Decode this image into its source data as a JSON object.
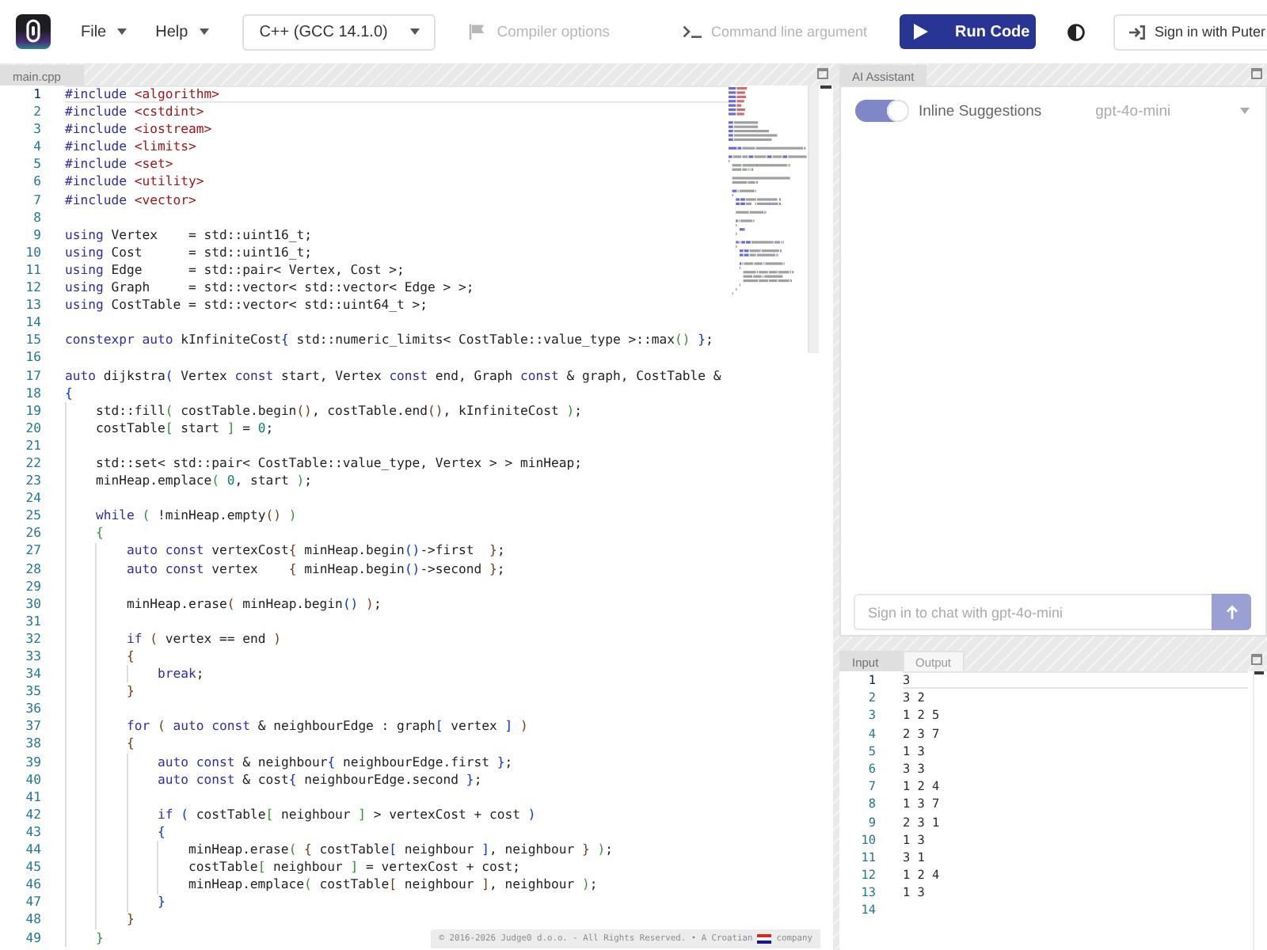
{
  "topbar": {
    "menus": [
      {
        "label": "File"
      },
      {
        "label": "Help"
      }
    ],
    "language": {
      "value": "C++ (GCC 14.1.0)"
    },
    "compiler_options": {
      "label": "Compiler options",
      "disabled": true
    },
    "arguments": {
      "placeholder": "Command line argument"
    },
    "run_button": {
      "label": "Run Code"
    },
    "sign_in": {
      "label": "Sign in with Puter"
    }
  },
  "editor": {
    "tab": "main.cpp",
    "lines": [
      {
        "number": "1",
        "active": true,
        "tokens": [
          {
            "kind": "keyword",
            "text": "#include"
          },
          {
            "kind": "header",
            "text": " <algorithm>"
          }
        ]
      },
      {
        "number": "2",
        "active": false,
        "tokens": [
          {
            "kind": "keyword",
            "text": "#include"
          },
          {
            "kind": "header",
            "text": " <cstdint>"
          }
        ]
      },
      {
        "number": "3",
        "active": false,
        "tokens": [
          {
            "kind": "keyword",
            "text": "#include"
          },
          {
            "kind": "header",
            "text": " <iostream>"
          }
        ]
      },
      {
        "number": "4",
        "active": false,
        "tokens": [
          {
            "kind": "keyword",
            "text": "#include"
          },
          {
            "kind": "header",
            "text": " <limits>"
          }
        ]
      },
      {
        "number": "5",
        "active": false,
        "tokens": [
          {
            "kind": "keyword",
            "text": "#include"
          },
          {
            "kind": "header",
            "text": " <set>"
          }
        ]
      },
      {
        "number": "6",
        "active": false,
        "tokens": [
          {
            "kind": "keyword",
            "text": "#include"
          },
          {
            "kind": "header",
            "text": " <utility>"
          }
        ]
      },
      {
        "number": "7",
        "active": false,
        "tokens": [
          {
            "kind": "keyword",
            "text": "#include"
          },
          {
            "kind": "header",
            "text": " <vector>"
          }
        ]
      },
      {
        "number": "8",
        "active": false
      },
      {
        "number": "9",
        "active": false,
        "tokens": [
          {
            "kind": "keyword",
            "text": "using"
          },
          {
            "kind": "text",
            "text": " Vertex    = std::uint16_t;"
          }
        ]
      },
      {
        "number": "10",
        "active": false,
        "tokens": [
          {
            "kind": "keyword",
            "text": "using"
          },
          {
            "kind": "text",
            "text": " Cost      = std::uint16_t;"
          }
        ]
      },
      {
        "number": "11",
        "active": false,
        "tokens": [
          {
            "kind": "keyword",
            "text": "using"
          },
          {
            "kind": "text",
            "text": " Edge      = std::pair< Vertex, Cost >;"
          }
        ]
      },
      {
        "number": "12",
        "active": false,
        "tokens": [
          {
            "kind": "keyword",
            "text": "using"
          },
          {
            "kind": "text",
            "text": " Graph     = std::vector< std::vector< Edge > >;"
          }
        ]
      },
      {
        "number": "13",
        "active": false,
        "tokens": [
          {
            "kind": "keyword",
            "text": "using"
          },
          {
            "kind": "text",
            "text": " CostTable = std::vector< std::uint64_t >;"
          }
        ]
      },
      {
        "number": "14",
        "active": false
      },
      {
        "number": "15",
        "active": false,
        "tokens": [
          {
            "kind": "keyword",
            "text": "constexpr"
          },
          {
            "kind": "keyword",
            "text": " auto"
          },
          {
            "kind": "text",
            "text": " kInfiniteCost"
          },
          {
            "kind": "bracket1",
            "text": "{"
          },
          {
            "kind": "text",
            "text": " std::numeric_limits< CostTable::value_type >::max"
          },
          {
            "kind": "bracket2",
            "text": "()"
          },
          {
            "kind": "bracket1",
            "text": " }"
          },
          {
            "kind": "text",
            "text": ";"
          }
        ]
      },
      {
        "number": "16",
        "active": false
      },
      {
        "number": "17",
        "active": false,
        "tokens": [
          {
            "kind": "keyword",
            "text": "auto"
          },
          {
            "kind": "text",
            "text": " dijkstra"
          },
          {
            "kind": "bracket1",
            "text": "("
          },
          {
            "kind": "text",
            "text": " Vertex "
          },
          {
            "kind": "keyword",
            "text": "const"
          },
          {
            "kind": "text",
            "text": " start, Vertex "
          },
          {
            "kind": "keyword",
            "text": "const"
          },
          {
            "kind": "text",
            "text": " end, Graph "
          },
          {
            "kind": "keyword",
            "text": "const"
          },
          {
            "kind": "text",
            "text": " & graph, CostTable &"
          }
        ]
      },
      {
        "number": "18",
        "active": false,
        "tokens": [
          {
            "kind": "bracket1",
            "text": "{"
          }
        ]
      },
      {
        "number": "19",
        "active": false,
        "tokens": [
          {
            "kind": "text",
            "text": "    std::fill"
          },
          {
            "kind": "bracket2",
            "text": "("
          },
          {
            "kind": "text",
            "text": " costTable.begin"
          },
          {
            "kind": "bracket3",
            "text": "()"
          },
          {
            "kind": "text",
            "text": ", costTable.end"
          },
          {
            "kind": "bracket3",
            "text": "()"
          },
          {
            "kind": "text",
            "text": ", kInfiniteCost"
          },
          {
            "kind": "bracket2",
            "text": " )"
          },
          {
            "kind": "text",
            "text": ";"
          }
        ]
      },
      {
        "number": "20",
        "active": false,
        "tokens": [
          {
            "kind": "text",
            "text": "    costTable"
          },
          {
            "kind": "bracket2",
            "text": "["
          },
          {
            "kind": "text",
            "text": " start"
          },
          {
            "kind": "bracket2",
            "text": " ]"
          },
          {
            "kind": "text",
            "text": " ="
          },
          {
            "kind": "number",
            "text": " 0"
          },
          {
            "kind": "text",
            "text": ";"
          }
        ]
      },
      {
        "number": "21",
        "active": false
      },
      {
        "number": "22",
        "active": false,
        "tokens": [
          {
            "kind": "text",
            "text": "    std::set< std::pair< CostTable::value_type, Vertex > > minHeap;"
          }
        ]
      },
      {
        "number": "23",
        "active": false,
        "tokens": [
          {
            "kind": "text",
            "text": "    minHeap.emplace"
          },
          {
            "kind": "bracket2",
            "text": "("
          },
          {
            "kind": "number",
            "text": " 0"
          },
          {
            "kind": "text",
            "text": ", start"
          },
          {
            "kind": "bracket2",
            "text": " )"
          },
          {
            "kind": "text",
            "text": ";"
          }
        ]
      },
      {
        "number": "24",
        "active": false
      },
      {
        "number": "25",
        "active": false,
        "tokens": [
          {
            "kind": "keyword",
            "text": "    while"
          },
          {
            "kind": "bracket2",
            "text": " ("
          },
          {
            "kind": "text",
            "text": " !minHeap.empty"
          },
          {
            "kind": "bracket3",
            "text": "()"
          },
          {
            "kind": "bracket2",
            "text": " )"
          }
        ]
      },
      {
        "number": "26",
        "active": false,
        "tokens": [
          {
            "kind": "bracket2",
            "text": "    {"
          }
        ]
      },
      {
        "number": "27",
        "active": false,
        "tokens": [
          {
            "kind": "keyword",
            "text": "        auto"
          },
          {
            "kind": "keyword",
            "text": " const"
          },
          {
            "kind": "text",
            "text": " vertexCost"
          },
          {
            "kind": "bracket3",
            "text": "{"
          },
          {
            "kind": "text",
            "text": " minHeap.begin"
          },
          {
            "kind": "bracket1",
            "text": "()"
          },
          {
            "kind": "text",
            "text": "->first"
          },
          {
            "kind": "bracket3",
            "text": "  }"
          },
          {
            "kind": "text",
            "text": ";"
          }
        ]
      },
      {
        "number": "28",
        "active": false,
        "tokens": [
          {
            "kind": "keyword",
            "text": "        auto"
          },
          {
            "kind": "keyword",
            "text": " const"
          },
          {
            "kind": "text",
            "text": " vertex    "
          },
          {
            "kind": "bracket3",
            "text": "{"
          },
          {
            "kind": "text",
            "text": " minHeap.begin"
          },
          {
            "kind": "bracket1",
            "text": "()"
          },
          {
            "kind": "text",
            "text": "->second"
          },
          {
            "kind": "bracket3",
            "text": " }"
          },
          {
            "kind": "text",
            "text": ";"
          }
        ]
      },
      {
        "number": "29",
        "active": false
      },
      {
        "number": "30",
        "active": false,
        "tokens": [
          {
            "kind": "text",
            "text": "        minHeap.erase"
          },
          {
            "kind": "bracket3",
            "text": "("
          },
          {
            "kind": "text",
            "text": " minHeap.begin"
          },
          {
            "kind": "bracket1",
            "text": "()"
          },
          {
            "kind": "bracket3",
            "text": " )"
          },
          {
            "kind": "text",
            "text": ";"
          }
        ]
      },
      {
        "number": "31",
        "active": false
      },
      {
        "number": "32",
        "active": false,
        "tokens": [
          {
            "kind": "keyword",
            "text": "        if"
          },
          {
            "kind": "bracket3",
            "text": " ("
          },
          {
            "kind": "text",
            "text": " vertex == end"
          },
          {
            "kind": "bracket3",
            "text": " )"
          }
        ]
      },
      {
        "number": "33",
        "active": false,
        "tokens": [
          {
            "kind": "bracket3",
            "text": "        {"
          }
        ]
      },
      {
        "number": "34",
        "active": false,
        "tokens": [
          {
            "kind": "keyword",
            "text": "            break"
          },
          {
            "kind": "text",
            "text": ";"
          }
        ]
      },
      {
        "number": "35",
        "active": false,
        "tokens": [
          {
            "kind": "bracket3",
            "text": "        }"
          }
        ]
      },
      {
        "number": "36",
        "active": false
      },
      {
        "number": "37",
        "active": false,
        "tokens": [
          {
            "kind": "keyword",
            "text": "        for"
          },
          {
            "kind": "bracket3",
            "text": " ("
          },
          {
            "kind": "keyword",
            "text": " auto"
          },
          {
            "kind": "keyword",
            "text": " const"
          },
          {
            "kind": "text",
            "text": " & neighbourEdge : graph"
          },
          {
            "kind": "bracket1",
            "text": "["
          },
          {
            "kind": "text",
            "text": " vertex"
          },
          {
            "kind": "bracket1",
            "text": " ]"
          },
          {
            "kind": "bracket3",
            "text": " )"
          }
        ]
      },
      {
        "number": "38",
        "active": false,
        "tokens": [
          {
            "kind": "bracket3",
            "text": "        {"
          }
        ]
      },
      {
        "number": "39",
        "active": false,
        "tokens": [
          {
            "kind": "keyword",
            "text": "            auto"
          },
          {
            "kind": "keyword",
            "text": " const"
          },
          {
            "kind": "text",
            "text": " & neighbour"
          },
          {
            "kind": "bracket1",
            "text": "{"
          },
          {
            "kind": "text",
            "text": " neighbourEdge.first"
          },
          {
            "kind": "bracket1",
            "text": " }"
          },
          {
            "kind": "text",
            "text": ";"
          }
        ]
      },
      {
        "number": "40",
        "active": false,
        "tokens": [
          {
            "kind": "keyword",
            "text": "            auto"
          },
          {
            "kind": "keyword",
            "text": " const"
          },
          {
            "kind": "text",
            "text": " & cost"
          },
          {
            "kind": "bracket1",
            "text": "{"
          },
          {
            "kind": "text",
            "text": " neighbourEdge.second"
          },
          {
            "kind": "bracket1",
            "text": " }"
          },
          {
            "kind": "text",
            "text": ";"
          }
        ]
      },
      {
        "number": "41",
        "active": false
      },
      {
        "number": "42",
        "active": false,
        "tokens": [
          {
            "kind": "keyword",
            "text": "            if"
          },
          {
            "kind": "bracket1",
            "text": " ("
          },
          {
            "kind": "text",
            "text": " costTable"
          },
          {
            "kind": "bracket2",
            "text": "["
          },
          {
            "kind": "text",
            "text": " neighbour"
          },
          {
            "kind": "bracket2",
            "text": " ]"
          },
          {
            "kind": "text",
            "text": " > vertexCost + cost"
          },
          {
            "kind": "bracket1",
            "text": " )"
          }
        ]
      },
      {
        "number": "43",
        "active": false,
        "tokens": [
          {
            "kind": "bracket1",
            "text": "            {"
          }
        ]
      },
      {
        "number": "44",
        "active": false,
        "tokens": [
          {
            "kind": "text",
            "text": "                minHeap.erase"
          },
          {
            "kind": "bracket2",
            "text": "("
          },
          {
            "kind": "bracket3",
            "text": " {"
          },
          {
            "kind": "text",
            "text": " costTable"
          },
          {
            "kind": "bracket1",
            "text": "["
          },
          {
            "kind": "text",
            "text": " neighbour"
          },
          {
            "kind": "bracket1",
            "text": " ]"
          },
          {
            "kind": "text",
            "text": ", neighbour"
          },
          {
            "kind": "bracket3",
            "text": " }"
          },
          {
            "kind": "bracket2",
            "text": " )"
          },
          {
            "kind": "text",
            "text": ";"
          }
        ]
      },
      {
        "number": "45",
        "active": false,
        "tokens": [
          {
            "kind": "text",
            "text": "                costTable"
          },
          {
            "kind": "bracket2",
            "text": "["
          },
          {
            "kind": "text",
            "text": " neighbour"
          },
          {
            "kind": "bracket2",
            "text": " ]"
          },
          {
            "kind": "text",
            "text": " = vertexCost + cost;"
          }
        ]
      },
      {
        "number": "46",
        "active": false,
        "tokens": [
          {
            "kind": "text",
            "text": "                minHeap.emplace"
          },
          {
            "kind": "bracket2",
            "text": "("
          },
          {
            "kind": "text",
            "text": " costTable"
          },
          {
            "kind": "bracket3",
            "text": "["
          },
          {
            "kind": "text",
            "text": " neighbour"
          },
          {
            "kind": "bracket3",
            "text": " ]"
          },
          {
            "kind": "text",
            "text": ", neighbour"
          },
          {
            "kind": "bracket2",
            "text": " )"
          },
          {
            "kind": "text",
            "text": ";"
          }
        ]
      },
      {
        "number": "47",
        "active": false,
        "tokens": [
          {
            "kind": "bracket1",
            "text": "            }"
          }
        ]
      },
      {
        "number": "48",
        "active": false,
        "tokens": [
          {
            "kind": "bracket3",
            "text": "        }"
          }
        ]
      },
      {
        "number": "49",
        "active": false,
        "tokens": [
          {
            "kind": "bracket2",
            "text": "    }"
          }
        ]
      }
    ]
  },
  "footer": {
    "text": "© 2016-2026 Judge0 d.o.o. - All Rights Reserved. • A Croatian",
    "suffix": "company"
  },
  "assistant": {
    "tab": "AI Assistant",
    "inline_suggestions": {
      "label": "Inline Suggestions",
      "on": true
    },
    "model": {
      "value": "gpt-4o-mini",
      "disabled": true
    },
    "chat": {
      "placeholder": "Sign in to chat with gpt-4o-mini",
      "disabled": true
    }
  },
  "io": {
    "tabs": [
      {
        "label": "Input",
        "selected": true
      },
      {
        "label": "Output",
        "selected": false
      }
    ],
    "lines": [
      {
        "number": "1",
        "text": "3",
        "active": true
      },
      {
        "number": "2",
        "text": "3 2",
        "active": false
      },
      {
        "number": "3",
        "text": "1 2 5",
        "active": false
      },
      {
        "number": "4",
        "text": "2 3 7",
        "active": false
      },
      {
        "number": "5",
        "text": "1 3",
        "active": false
      },
      {
        "number": "6",
        "text": "3 3",
        "active": false
      },
      {
        "number": "7",
        "text": "1 2 4",
        "active": false
      },
      {
        "number": "8",
        "text": "1 3 7",
        "active": false
      },
      {
        "number": "9",
        "text": "2 3 1",
        "active": false
      },
      {
        "number": "10",
        "text": "1 3",
        "active": false
      },
      {
        "number": "11",
        "text": "3 1",
        "active": false
      },
      {
        "number": "12",
        "text": "1 2 4",
        "active": false
      },
      {
        "number": "13",
        "text": "1 3",
        "active": false
      },
      {
        "number": "14",
        "active": false
      }
    ]
  }
}
